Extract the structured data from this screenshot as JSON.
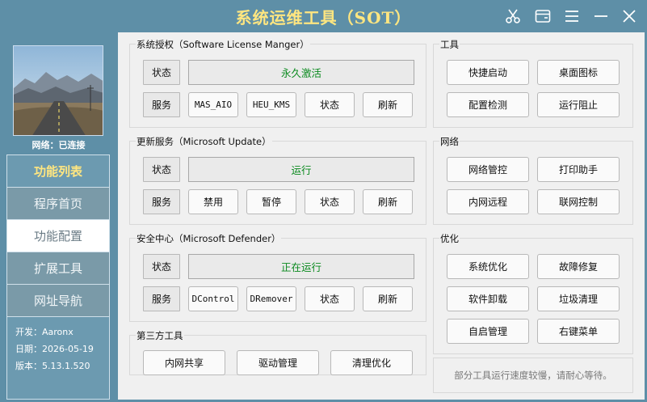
{
  "app": {
    "title": "系统运维工具（SOT）",
    "title_color": "#ffe680",
    "icons": [
      "scissors-icon",
      "window-icon",
      "menu-icon",
      "minimize-icon",
      "close-icon"
    ]
  },
  "sidebar": {
    "network_status": "网络：已连接",
    "nav_header": "功能列表",
    "nav_items": [
      {
        "label": "程序首页"
      },
      {
        "label": "功能配置",
        "active": true
      },
      {
        "label": "扩展工具"
      },
      {
        "label": "网址导航"
      }
    ],
    "info": {
      "developer": "开发：Aaronx",
      "date": "日期：2026-05-19",
      "version": "版本：5.13.1.520"
    }
  },
  "groups": {
    "license": {
      "title": "系统授权（Software License Manger）",
      "status_label": "状态",
      "status_value": "永久激活",
      "service_label": "服务",
      "buttons": [
        "MAS_AIO",
        "HEU_KMS",
        "状态",
        "刷新"
      ]
    },
    "update": {
      "title": "更新服务（Microsoft Update）",
      "status_label": "状态",
      "status_value": "运行",
      "service_label": "服务",
      "buttons": [
        "禁用",
        "暂停",
        "状态",
        "刷新"
      ]
    },
    "defender": {
      "title": "安全中心（Microsoft Defender）",
      "status_label": "状态",
      "status_value": "正在运行",
      "service_label": "服务",
      "buttons": [
        "DControl",
        "DRemover",
        "状态",
        "刷新"
      ]
    },
    "third_party": {
      "title": "第三方工具",
      "buttons": [
        "内网共享",
        "驱动管理",
        "清理优化"
      ]
    },
    "tools": {
      "title": "工具",
      "buttons": [
        "快捷启动",
        "桌面图标",
        "配置检测",
        "运行阻止"
      ]
    },
    "network": {
      "title": "网络",
      "buttons": [
        "网络管控",
        "打印助手",
        "内网远程",
        "联网控制"
      ]
    },
    "optimize": {
      "title": "优化",
      "buttons": [
        "系统优化",
        "故障修复",
        "软件卸载",
        "垃圾清理",
        "自启管理",
        "右键菜单"
      ]
    }
  },
  "footer_note": "部分工具运行速度较慢，请耐心等待。",
  "colors": {
    "chrome": "#5e8fa7",
    "status_text": "#0a8a1e",
    "accent_text": "#ffe680"
  }
}
